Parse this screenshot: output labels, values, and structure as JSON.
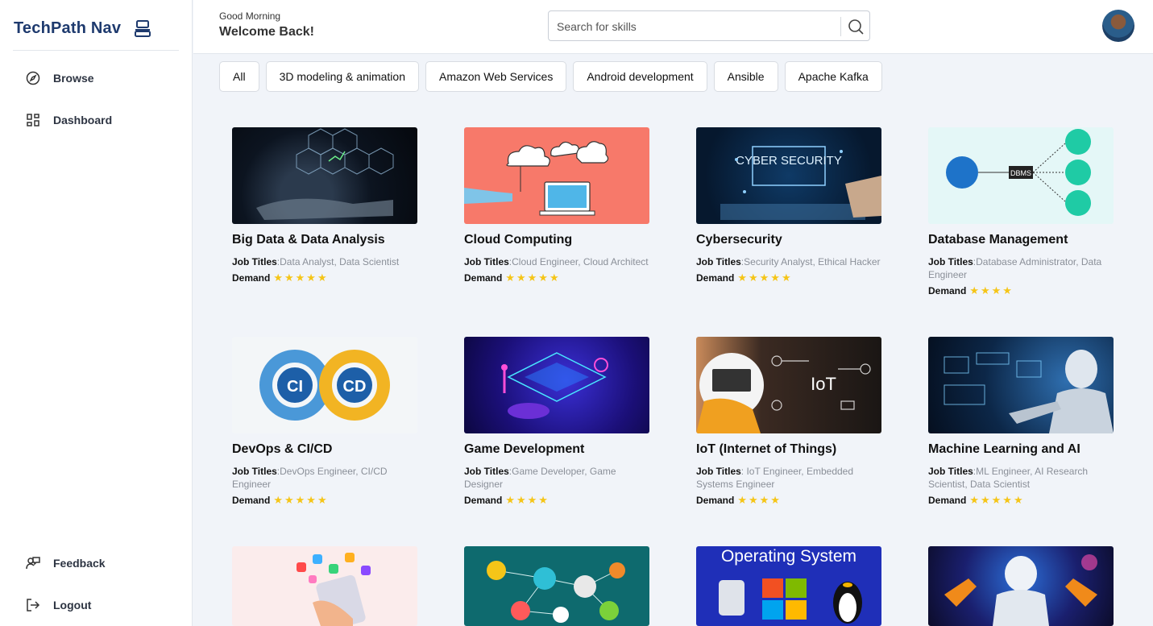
{
  "sidebar": {
    "brand": "TechPath Nav",
    "items": [
      {
        "label": "Browse"
      },
      {
        "label": "Dashboard"
      },
      {
        "label": "Feedback"
      },
      {
        "label": "Logout"
      }
    ]
  },
  "header": {
    "greeting": "Good Morning",
    "welcome": "Welcome Back!",
    "search_placeholder": "Search for skills"
  },
  "filters": [
    "All",
    "3D modeling & animation",
    "Amazon Web Services",
    "Android development",
    "Ansible",
    "Apache Kafka"
  ],
  "cards": [
    {
      "title": "Big Data & Data Analysis",
      "job_label": "Job Titles",
      "jobs": "Data Analyst, Data Scientist",
      "demand_label": "Demand",
      "stars": "★★★★★"
    },
    {
      "title": "Cloud Computing",
      "job_label": "Job Titles",
      "jobs": "Cloud Engineer, Cloud Architect",
      "demand_label": "Demand",
      "stars": "★★★★★"
    },
    {
      "title": "Cybersecurity",
      "job_label": "Job Titles",
      "jobs": "Security Analyst, Ethical Hacker",
      "demand_label": "Demand",
      "stars": "★★★★★"
    },
    {
      "title": "Database Management",
      "job_label": "Job Titles",
      "jobs": "Database Administrator, Data Engineer",
      "demand_label": "Demand",
      "stars": "★★★★"
    },
    {
      "title": "DevOps & CI/CD",
      "job_label": "Job Titles",
      "jobs": "DevOps Engineer, CI/CD Engineer",
      "demand_label": "Demand",
      "stars": "★★★★★"
    },
    {
      "title": "Game Development",
      "job_label": "Job Titles",
      "jobs": "Game Developer, Game Designer",
      "demand_label": "Demand",
      "stars": "★★★★"
    },
    {
      "title": "IoT (Internet of Things)",
      "job_label": "Job Titles",
      "jobs": " IoT Engineer, Embedded Systems Engineer",
      "demand_label": "Demand",
      "stars": "★★★★"
    },
    {
      "title": "Machine Learning and AI",
      "job_label": "Job Titles",
      "jobs": "ML Engineer, AI Research Scientist, Data Scientist",
      "demand_label": "Demand",
      "stars": "★★★★★"
    }
  ],
  "image_text": {
    "cyber": "CYBER SECURITY",
    "dbms": "DBMS",
    "ci": "CI",
    "cd": "CD",
    "iot": "IoT",
    "os": "Operating System"
  }
}
